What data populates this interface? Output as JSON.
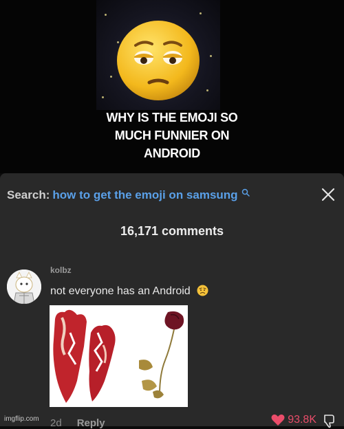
{
  "video": {
    "caption_line1": "WHY IS THE EMOJI SO",
    "caption_line2": "MUCH FUNNIER ON",
    "caption_line3": "ANDROID"
  },
  "comments_sheet": {
    "search_label": "Search:",
    "search_query": "how to get the emoji on samsung",
    "comment_count": "16,171 comments",
    "comment": {
      "username": "kolbz",
      "text": "not everyone has an Android",
      "age": "2d",
      "reply_label": "Reply",
      "likes": "93.8K"
    }
  },
  "watermark": "imgflip.com",
  "colors": {
    "sheet_bg": "#292929",
    "search_link": "#5aa0e8",
    "like_heart": "#ea4d6a"
  }
}
